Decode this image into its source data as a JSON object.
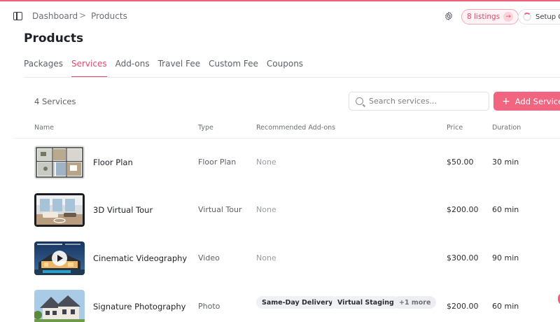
{
  "breadcrumb": {
    "root": "Dashboard",
    "separator": ">",
    "current": "Products"
  },
  "header": {
    "listings_label": "8 listings",
    "setup_label": "Setup G",
    "accent_color": "#f26580"
  },
  "page": {
    "title": "Products"
  },
  "tabs": [
    {
      "label": "Packages",
      "active": false
    },
    {
      "label": "Services",
      "active": true
    },
    {
      "label": "Add-ons",
      "active": false
    },
    {
      "label": "Travel Fee",
      "active": false
    },
    {
      "label": "Custom Fee",
      "active": false
    },
    {
      "label": "Coupons",
      "active": false
    }
  ],
  "toolbar": {
    "count": "4 Services",
    "search_placeholder": "Search services...",
    "add_label": "Add Service"
  },
  "table": {
    "columns": {
      "name": "Name",
      "type": "Type",
      "addons": "Recommended Add-ons",
      "price": "Price",
      "duration": "Duration"
    },
    "rows": [
      {
        "name": "Floor Plan",
        "type": "Floor Plan",
        "addons": "None",
        "chips": [],
        "price": "$50.00",
        "duration": "30 min",
        "thumb": "floor-plan"
      },
      {
        "name": "3D Virtual Tour",
        "type": "Virtual Tour",
        "addons": "None",
        "chips": [],
        "price": "$200.00",
        "duration": "60 min",
        "thumb": "virtual-tour"
      },
      {
        "name": "Cinematic Videography",
        "type": "Video",
        "addons": "None",
        "chips": [],
        "price": "$300.00",
        "duration": "90 min",
        "thumb": "video"
      },
      {
        "name": "Signature Photography",
        "type": "Photo",
        "addons": "",
        "chips": [
          "Same-Day Delivery",
          "Virtual Staging",
          "+1 more"
        ],
        "price": "$200.00",
        "duration": "60 min",
        "thumb": "photo"
      }
    ]
  }
}
